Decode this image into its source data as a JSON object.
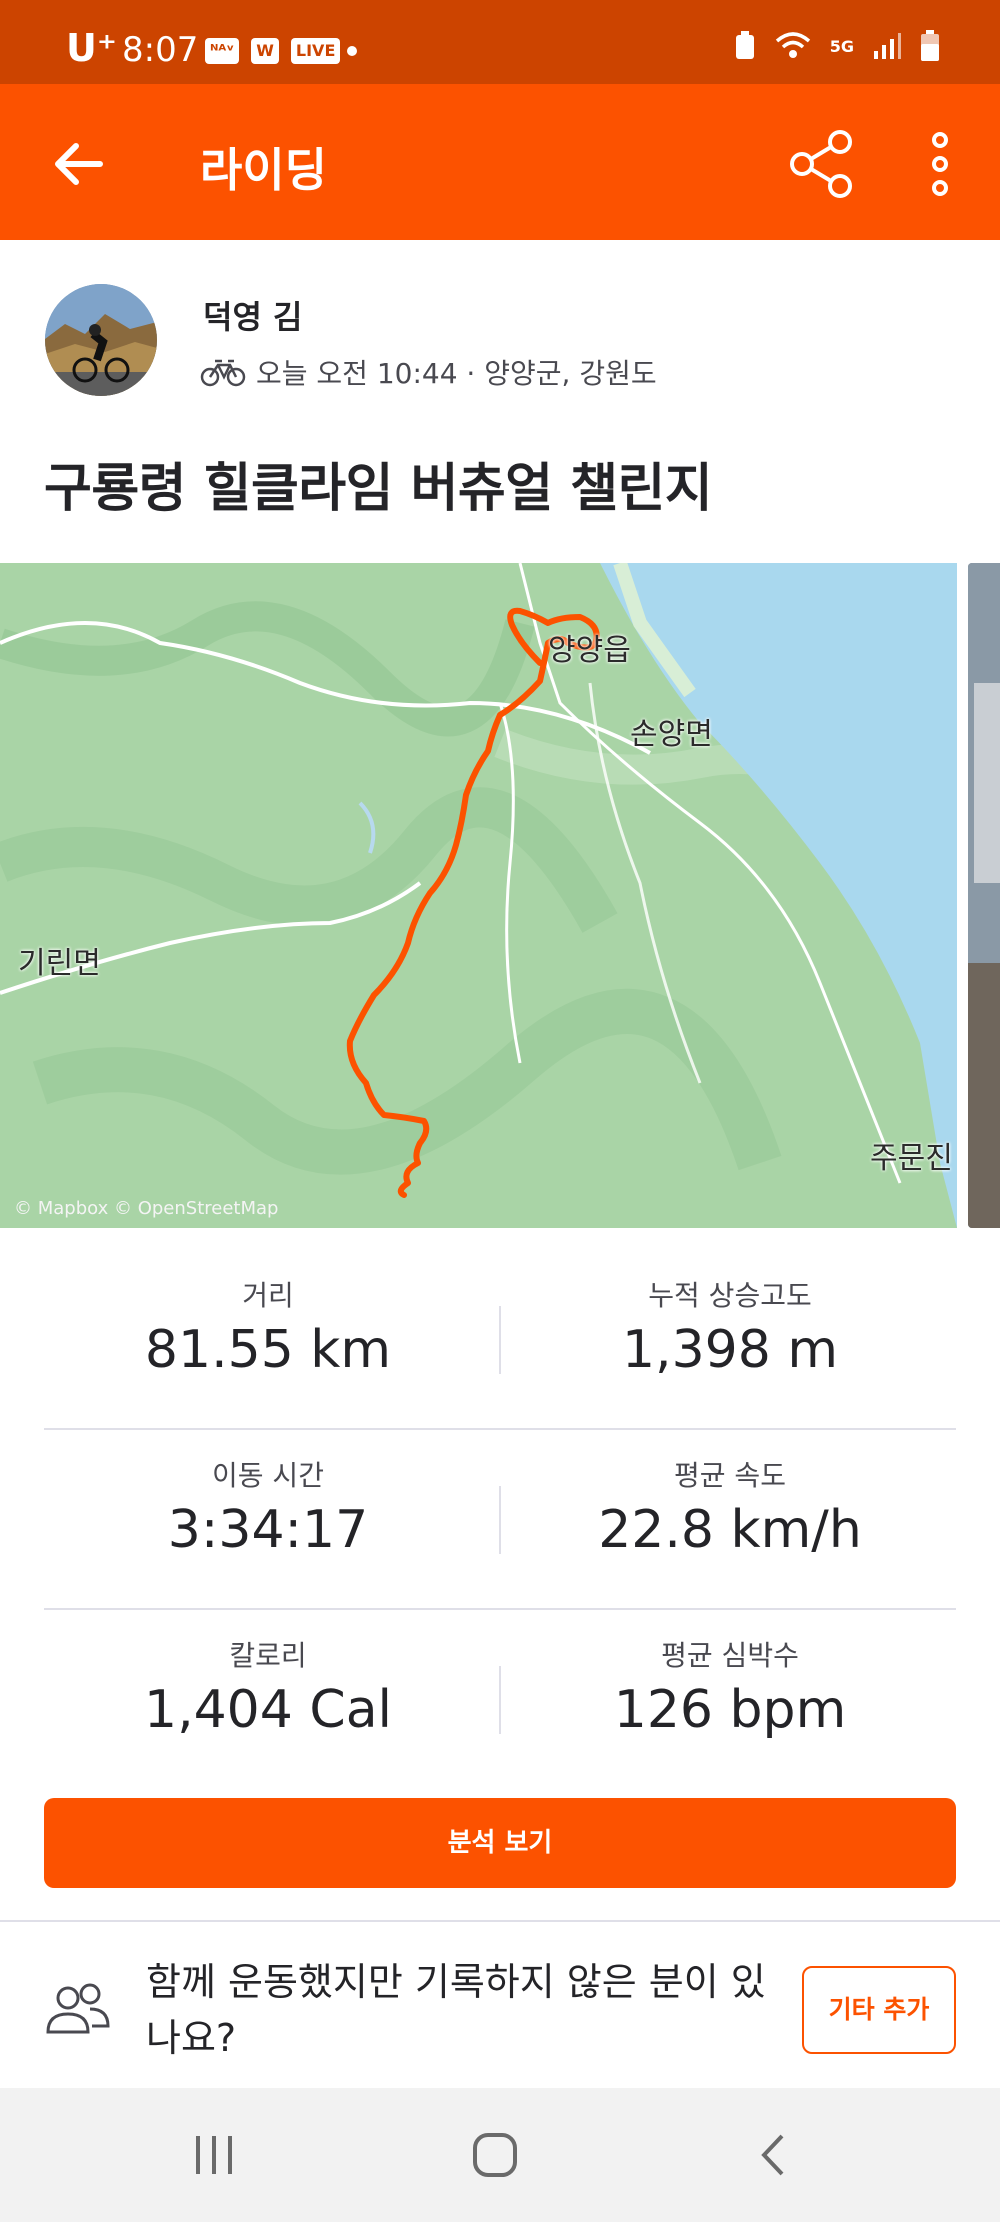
{
  "status_bar": {
    "carrier": "U⁺",
    "time": "8:07",
    "apps": [
      "ᴺᴬᵛ",
      "W",
      "LIVE"
    ],
    "network": "5G"
  },
  "app_bar": {
    "title": "라이딩"
  },
  "activity": {
    "athlete_name": "덕영 김",
    "meta": "오늘 오전 10:44 · 양양군, 강원도",
    "title": "구룡령 힐클라임 버츄얼 챌린지"
  },
  "map": {
    "labels": {
      "yangyang": "양양읍",
      "sonyang": "손양면",
      "girin": "기린면",
      "jumun": "주문진"
    },
    "credit": "© Mapbox © OpenStreetMap",
    "colors": {
      "route": "#fc5200",
      "sea": "#a9d8ee",
      "land": "#a7d3a7"
    }
  },
  "stats": [
    {
      "label": "거리",
      "value": "81.55 km"
    },
    {
      "label": "누적 상승고도",
      "value": "1,398 m"
    },
    {
      "label": "이동 시간",
      "value": "3:34:17"
    },
    {
      "label": "평균 속도",
      "value": "22.8 km/h"
    },
    {
      "label": "칼로리",
      "value": "1,404 Cal"
    },
    {
      "label": "평균 심박수",
      "value": "126 bpm"
    }
  ],
  "analysis_button": "분석 보기",
  "group_prompt": {
    "text": "함께 운동했지만 기록하지 않은 분이 있나요?",
    "button": "기타 추가"
  },
  "colors": {
    "brand": "#fc5200",
    "status_bar": "#cc4400"
  }
}
